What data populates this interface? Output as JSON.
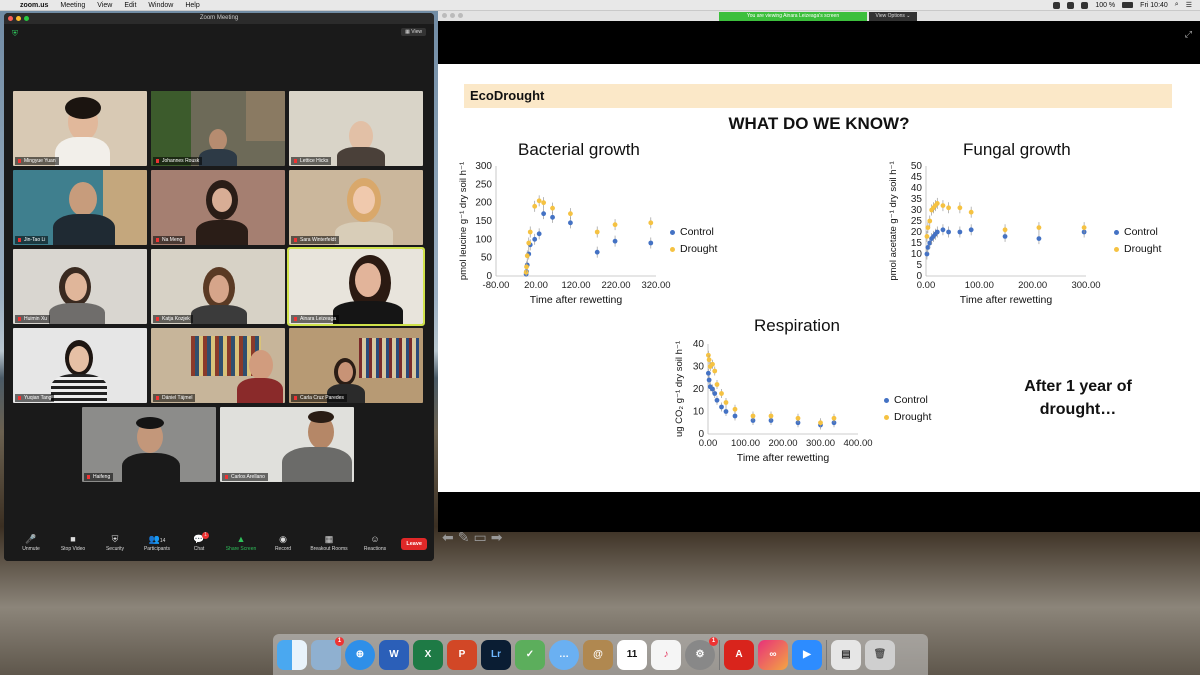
{
  "menubar": {
    "app": "zoom.us",
    "items": [
      "Meeting",
      "View",
      "Edit",
      "Window",
      "Help"
    ],
    "battery": "100 %",
    "clock": "Fri 10:40"
  },
  "zoom_window": {
    "title": "Zoom Meeting",
    "view_label": "View",
    "participants": [
      "Mingyue Yuan",
      "Johannes Rousk",
      "Lettice Hicks",
      "Jin-Tao Li",
      "Na Meng",
      "Sara Winterfeldt",
      "Huimin Xu",
      "Katja Kozjek",
      "Ainara Leizeaga",
      "Yuqian Tang",
      "Dániel Tájmel",
      "Carla Cruz Paredes",
      "Haifeng",
      "Carlos Arellano"
    ],
    "toolbar": {
      "unmute": "Unmute",
      "stop_video": "Stop Video",
      "security": "Security",
      "participants": "Participants",
      "participants_count": "14",
      "chat": "Chat",
      "chat_badge": "1",
      "share_screen": "Share Screen",
      "record": "Record",
      "breakout": "Breakout Rooms",
      "reactions": "Reactions",
      "leave": "Leave"
    }
  },
  "share_window": {
    "viewing_banner": "You are viewing Ainara Leizeaga's screen",
    "view_options": "View Options ⌄"
  },
  "slide": {
    "section": "EcoDrought",
    "heading": "WHAT DO WE KNOW?",
    "after_note_line1": "After 1 year of",
    "after_note_line2": "drought…"
  },
  "chart_data": [
    {
      "type": "scatter",
      "title": "Bacterial growth",
      "xlabel": "Time after rewetting",
      "ylabel": "pmol leucine g⁻¹ dry soil h⁻¹",
      "xticks": [
        "-80.00",
        "20.00",
        "120.00",
        "220.00",
        "320.00"
      ],
      "yticks": [
        "0",
        "50",
        "100",
        "150",
        "200",
        "250",
        "300"
      ],
      "xlim": [
        -80,
        350
      ],
      "ylim": [
        0,
        300
      ],
      "series": [
        {
          "name": "Control",
          "color": "#4472c4",
          "x": [
            1,
            2,
            4,
            8,
            12,
            24,
            36,
            48,
            72,
            120,
            192,
            240,
            336
          ],
          "y": [
            5,
            12,
            30,
            60,
            85,
            100,
            115,
            170,
            160,
            145,
            65,
            95,
            90
          ]
        },
        {
          "name": "Drought",
          "color": "#f5c242",
          "x": [
            1,
            2,
            4,
            8,
            12,
            24,
            36,
            48,
            72,
            120,
            192,
            240,
            336
          ],
          "y": [
            10,
            25,
            55,
            90,
            120,
            190,
            205,
            200,
            185,
            170,
            120,
            140,
            145
          ]
        }
      ]
    },
    {
      "type": "scatter",
      "title": "Fungal growth",
      "xlabel": "Time after rewetting",
      "ylabel": "pmol acetate g⁻¹ dry soil h⁻¹",
      "xticks": [
        "0.00",
        "100.00",
        "200.00",
        "300.00"
      ],
      "yticks": [
        "0",
        "5",
        "10",
        "15",
        "20",
        "25",
        "30",
        "35",
        "40",
        "45",
        "50"
      ],
      "xlim": [
        0,
        340
      ],
      "ylim": [
        0,
        50
      ],
      "series": [
        {
          "name": "Control",
          "color": "#4472c4",
          "x": [
            2,
            4,
            8,
            12,
            16,
            20,
            24,
            36,
            48,
            72,
            96,
            168,
            240,
            336
          ],
          "y": [
            10,
            13,
            15,
            17,
            18,
            19,
            20,
            21,
            20,
            20,
            21,
            18,
            17,
            20
          ]
        },
        {
          "name": "Drought",
          "color": "#f5c242",
          "x": [
            2,
            4,
            8,
            12,
            16,
            20,
            24,
            36,
            48,
            72,
            96,
            168,
            240,
            336
          ],
          "y": [
            18,
            22,
            25,
            30,
            31,
            32,
            33,
            32,
            31,
            31,
            29,
            21,
            22,
            22
          ]
        }
      ]
    },
    {
      "type": "scatter",
      "title": "Respiration",
      "xlabel": "Time after rewetting",
      "ylabel": "ug CO₂ g⁻¹ dry soil h⁻¹",
      "xticks": [
        "0.00",
        "100.00",
        "200.00",
        "300.00",
        "400.00"
      ],
      "yticks": [
        "0",
        "10",
        "20",
        "30",
        "40"
      ],
      "xlim": [
        0,
        400
      ],
      "ylim": [
        0,
        40
      ],
      "series": [
        {
          "name": "Control",
          "color": "#4472c4",
          "x": [
            1,
            3,
            6,
            12,
            18,
            24,
            36,
            48,
            72,
            120,
            168,
            240,
            300,
            336
          ],
          "y": [
            27,
            24,
            21,
            20,
            18,
            15,
            12,
            10,
            8,
            6,
            6,
            5,
            4,
            5
          ]
        },
        {
          "name": "Drought",
          "color": "#f5c242",
          "x": [
            1,
            3,
            6,
            12,
            18,
            24,
            36,
            48,
            72,
            120,
            168,
            240,
            300,
            336
          ],
          "y": [
            35,
            33,
            30,
            31,
            28,
            22,
            18,
            14,
            11,
            8,
            8,
            7,
            5,
            7
          ]
        }
      ]
    }
  ]
}
